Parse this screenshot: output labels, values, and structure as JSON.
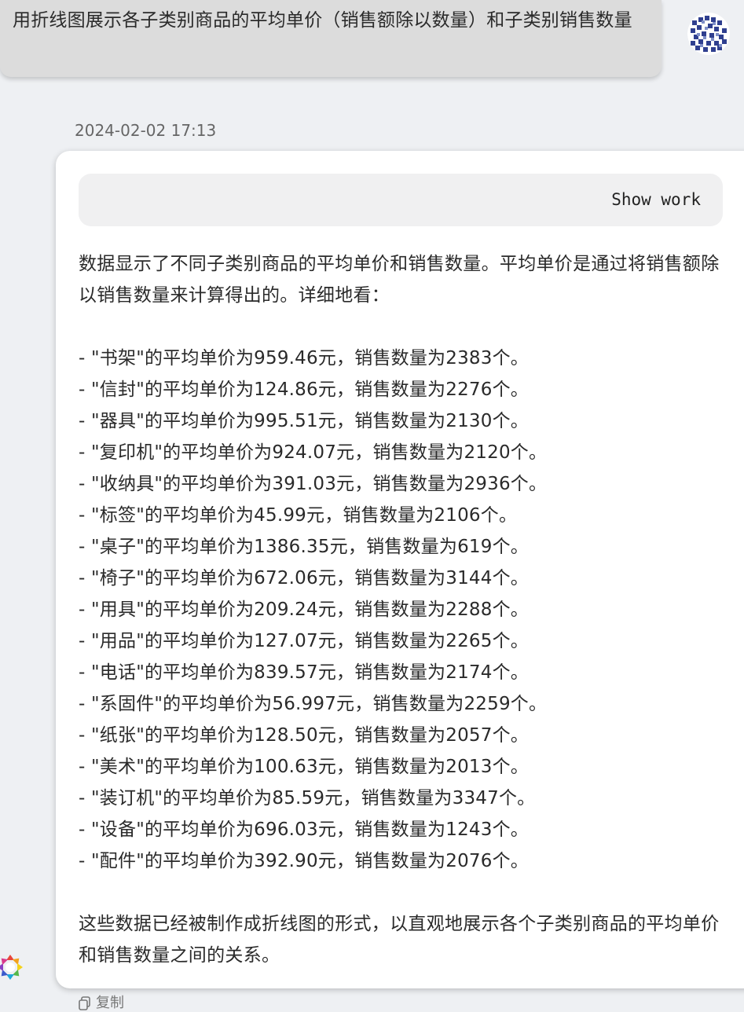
{
  "user_message": {
    "text": "用折线图展示各子类别商品的平均单价（销售额除以数量）和子类别销售数量"
  },
  "timestamp": "2024-02-02 17:13",
  "bot_message": {
    "show_work_label": "Show work",
    "intro": "数据显示了不同子类别商品的平均单价和销售数量。平均单价是通过将销售额除以销售数量来计算得出的。详细地看：",
    "items": [
      "- \"书架\"的平均单价为959.46元，销售数量为2383个。",
      "- \"信封\"的平均单价为124.86元，销售数量为2276个。",
      "- \"器具\"的平均单价为995.51元，销售数量为2130个。",
      "- \"复印机\"的平均单价为924.07元，销售数量为2120个。",
      "- \"收纳具\"的平均单价为391.03元，销售数量为2936个。",
      "- \"标签\"的平均单价为45.99元，销售数量为2106个。",
      "- \"桌子\"的平均单价为1386.35元，销售数量为619个。",
      "- \"椅子\"的平均单价为672.06元，销售数量为3144个。",
      "- \"用具\"的平均单价为209.24元，销售数量为2288个。",
      "- \"用品\"的平均单价为127.07元，销售数量为2265个。",
      "- \"电话\"的平均单价为839.57元，销售数量为2174个。",
      "- \"系固件\"的平均单价为56.997元，销售数量为2259个。",
      "- \"纸张\"的平均单价为128.50元，销售数量为2057个。",
      "- \"美术\"的平均单价为100.63元，销售数量为2013个。",
      "- \"装订机\"的平均单价为85.59元，销售数量为3347个。",
      "- \"设备\"的平均单价为696.03元，销售数量为1243个。",
      "- \"配件\"的平均单价为392.90元，销售数量为2076个。"
    ],
    "outro": "这些数据已经被制作成折线图的形式，以直观地展示各个子类别商品的平均单价和销售数量之间的关系。"
  },
  "copy_label": "复制",
  "icons": {
    "user_avatar": "user-avatar-pattern",
    "bot_avatar": "bot-logo-icon",
    "copy": "copy-icon"
  }
}
